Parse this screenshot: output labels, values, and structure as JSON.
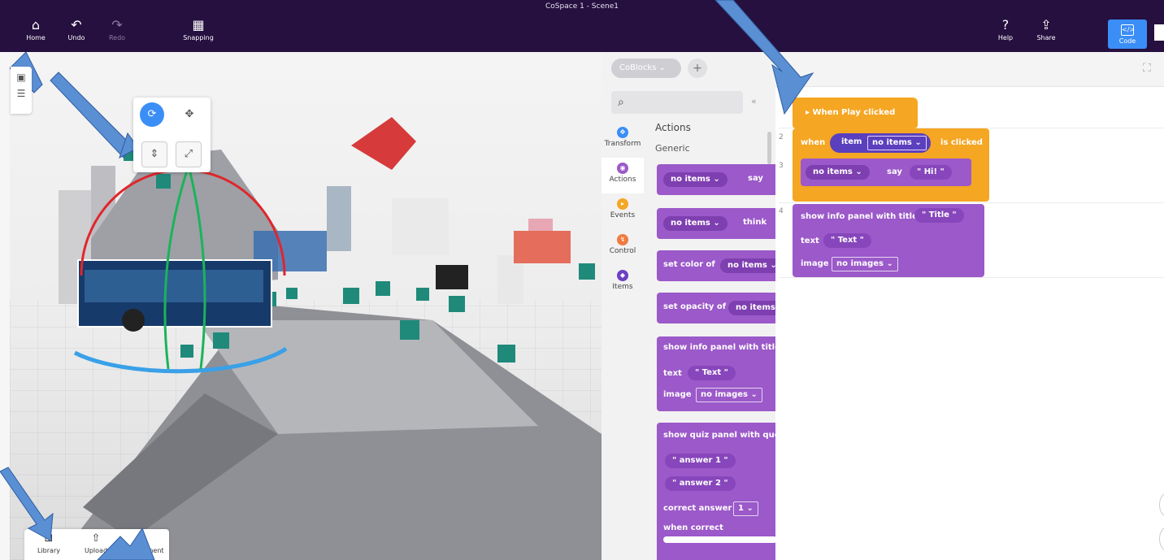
{
  "window": {
    "title": "CoSpace 1 - Scene1"
  },
  "toolbar": {
    "home": "Home",
    "undo": "Undo",
    "redo": "Redo",
    "snapping": "Snapping",
    "help": "Help",
    "share": "Share",
    "code": "Code"
  },
  "viewport": {
    "bottom_tabs": [
      "Library",
      "Upload",
      "Environment"
    ]
  },
  "tray": {
    "dropdown": "CoBlocks",
    "add": "+",
    "categories": [
      "Transform",
      "Actions",
      "Events",
      "Control",
      "Items"
    ],
    "palette": {
      "heading": "Actions",
      "sub": "Generic",
      "blocks": {
        "say_item": "no items",
        "say_word": "say",
        "think_item": "no items",
        "think_word": "think",
        "color_label": "set color of",
        "color_item": "no items",
        "opacity_label": "set opacity of",
        "opacity_item": "no items",
        "info_label": "show info panel with title",
        "info_text_label": "text",
        "info_text": "\" Text \"",
        "info_image_label": "image",
        "info_image": "no images",
        "quiz_label": "show quiz panel with ques",
        "answer1": "\" answer 1 \"",
        "answer2": "\" answer 2 \"",
        "correct_label": "correct answer",
        "correct_value": "1",
        "when_correct": "when correct"
      }
    }
  },
  "workspace": {
    "line_numbers": [
      "2",
      "3",
      "4"
    ],
    "hat": "When Play clicked",
    "when": {
      "when_word": "when",
      "item_word": "item",
      "item_select": "no items",
      "clicked": "is clicked"
    },
    "say": {
      "item": "no items",
      "say_word": "say",
      "text": "\" Hi! \""
    },
    "info": {
      "title_label": "show info panel with title",
      "title_value": "\" Title \"",
      "text_label": "text",
      "text_value": "\" Text \"",
      "image_label": "image",
      "image_value": "no images"
    }
  },
  "colors": {
    "topbar": "#26103f",
    "accent": "#3b8ef6",
    "actions_block": "#9b59c9",
    "events_block": "#f5a623"
  }
}
